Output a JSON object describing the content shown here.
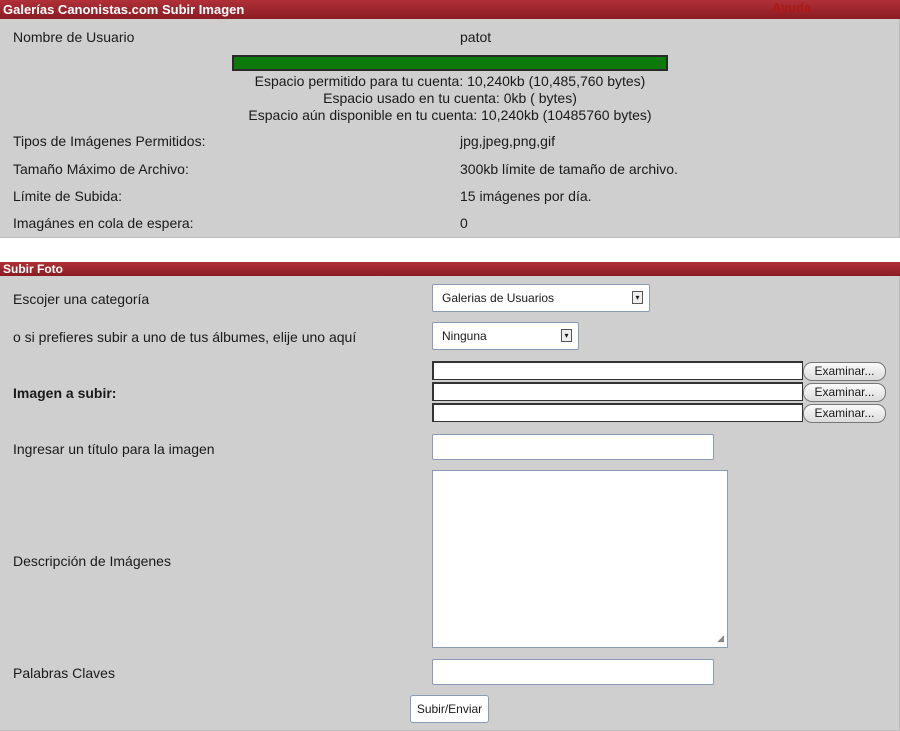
{
  "header": {
    "title": "Galerías Canonistas.com Subir Imagen",
    "help_link": "Ayuda"
  },
  "account": {
    "username_label": "Nombre de Usuario",
    "username": "patot",
    "quota_used_fraction": 1.0,
    "quota_lines": [
      "Espacio permitido para tu cuenta: 10,240kb (10,485,760 bytes)",
      "Espacio usado en tu cuenta: 0kb ( bytes)",
      "Espacio aún disponible en tu cuenta: 10,240kb (10485760 bytes)"
    ],
    "rows": [
      {
        "label": "Tipos de Imágenes Permitidos:",
        "value": "jpg,jpeg,png,gif"
      },
      {
        "label": "Tamaño Máximo de Archivo:",
        "value": "300kb límite de tamaño de archivo."
      },
      {
        "label": "Límite de Subida:",
        "value": "15 imágenes por día."
      },
      {
        "label": "Imagánes en cola de espera:",
        "value": "0"
      }
    ]
  },
  "upload": {
    "section_title": "Subir Foto",
    "category_label": "Escojer una categoría",
    "category_value": "Galerias de Usuarios",
    "album_label": "o si prefieres subir a uno de tus álbumes, elije uno aquí",
    "album_value": "Ninguna",
    "image_label": "Imagen a subir:",
    "browse_label": "Examinar...",
    "title_label": "Ingresar un título para la imagen",
    "description_label": "Descripción de Imágenes",
    "keywords_label": "Palabras Claves",
    "submit_label": "Subir/Enviar"
  },
  "colors": {
    "header_red": "#9e242b",
    "panel_gray": "#cfcfcf",
    "quota_green": "#0b7a0b"
  }
}
